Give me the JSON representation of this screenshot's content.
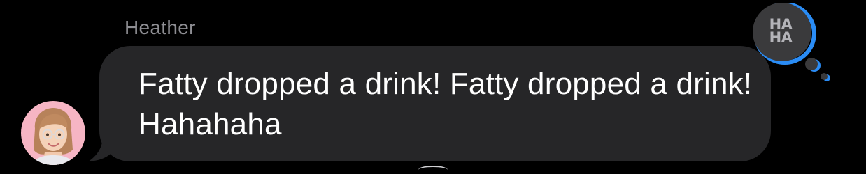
{
  "message": {
    "sender_name": "Heather",
    "text": "Fatty dropped a drink! Fatty dropped a drink! Hahahaha"
  },
  "tapback": {
    "label": "HA\nHA",
    "accent_color": "#2a8cf5",
    "icon": "haha-tapback-icon"
  },
  "avatar": {
    "icon": "memoji-avatar-icon",
    "background_color": "#f6b5c4"
  },
  "colors": {
    "background": "#000000",
    "bubble": "#262628",
    "sender_name": "#8e8e93",
    "text": "#ffffff"
  }
}
